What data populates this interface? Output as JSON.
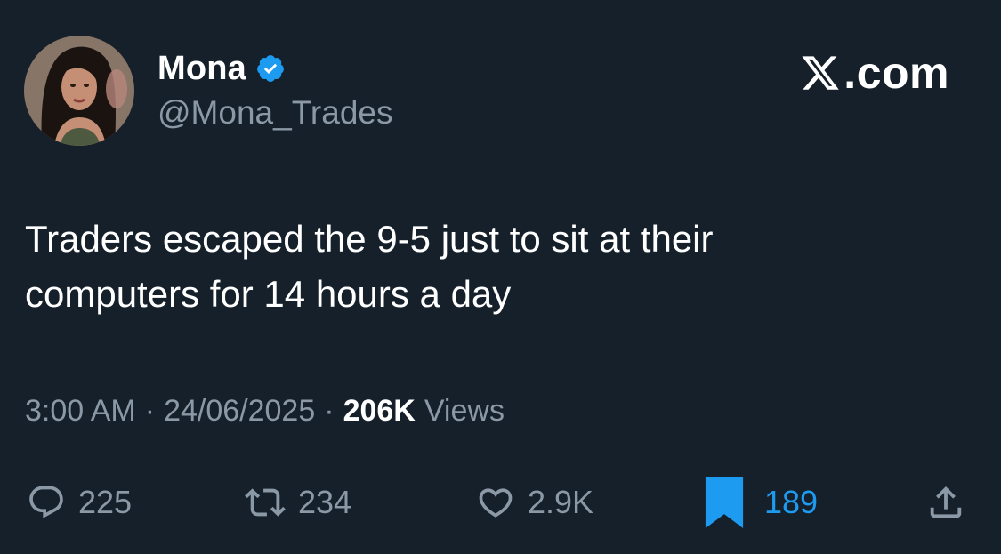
{
  "author": {
    "display_name": "Mona",
    "handle": "@Mona_Trades",
    "verified": true
  },
  "brand": {
    "text": ".com"
  },
  "tweet": {
    "text_line1": "Traders escaped the 9-5 just to sit at their",
    "text_line2": "computers for 14 hours a day"
  },
  "meta": {
    "time": "3:00 AM",
    "separator": "·",
    "date": "24/06/2025",
    "views_count": "206K",
    "views_label": "Views"
  },
  "actions": {
    "replies": "225",
    "retweets": "234",
    "likes": "2.9K",
    "bookmarks": "189"
  },
  "colors": {
    "background": "#15202b",
    "text_primary": "#ffffff",
    "text_secondary": "#8b98a5",
    "accent": "#1d9bf0"
  },
  "icons": {
    "verified": "verified-badge-icon",
    "brand": "x-logo-icon",
    "reply": "reply-icon",
    "retweet": "retweet-icon",
    "like": "heart-icon",
    "bookmark": "bookmark-icon",
    "share": "share-icon"
  }
}
